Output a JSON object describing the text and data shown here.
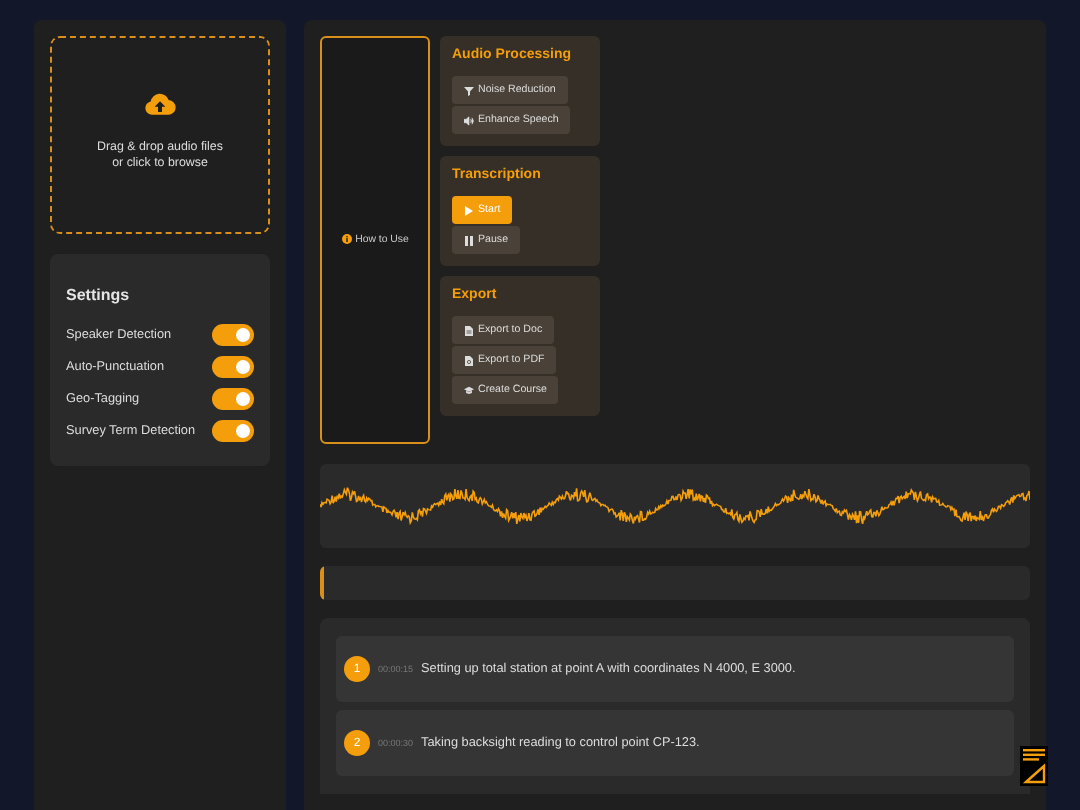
{
  "upload": {
    "text": "Drag & drop audio files",
    "subtext": "or click to browse"
  },
  "settings": {
    "title": "Settings",
    "items": [
      {
        "label": "Speaker Detection",
        "on": true
      },
      {
        "label": "Auto-Punctuation",
        "on": true
      },
      {
        "label": "Geo-Tagging",
        "on": true
      },
      {
        "label": "Survey Term Detection",
        "on": true
      }
    ]
  },
  "help": {
    "label": "How to Use"
  },
  "groups": [
    {
      "title": "Audio Processing",
      "buttons": [
        {
          "label": "Noise Reduction",
          "kind": "filter",
          "primary": false
        },
        {
          "label": "Enhance Speech",
          "kind": "speaker",
          "primary": false
        }
      ]
    },
    {
      "title": "Transcription",
      "buttons": [
        {
          "label": "Start",
          "kind": "play",
          "primary": true
        },
        {
          "label": "Pause",
          "kind": "pause",
          "primary": false
        }
      ]
    },
    {
      "title": "Export",
      "buttons": [
        {
          "label": "Export to Doc",
          "kind": "doc",
          "primary": false
        },
        {
          "label": "Export to PDF",
          "kind": "pdf",
          "primary": false
        },
        {
          "label": "Create Course",
          "kind": "cap",
          "primary": false
        }
      ]
    }
  ],
  "progress": {
    "level": 0
  },
  "transcript": [
    {
      "number": "1",
      "time": "00:00:15",
      "text": "Setting up total station at point A with coordinates N 4000, E 3000."
    },
    {
      "number": "2",
      "time": "00:00:30",
      "text": "Taking backsight reading to control point CP-123."
    }
  ]
}
